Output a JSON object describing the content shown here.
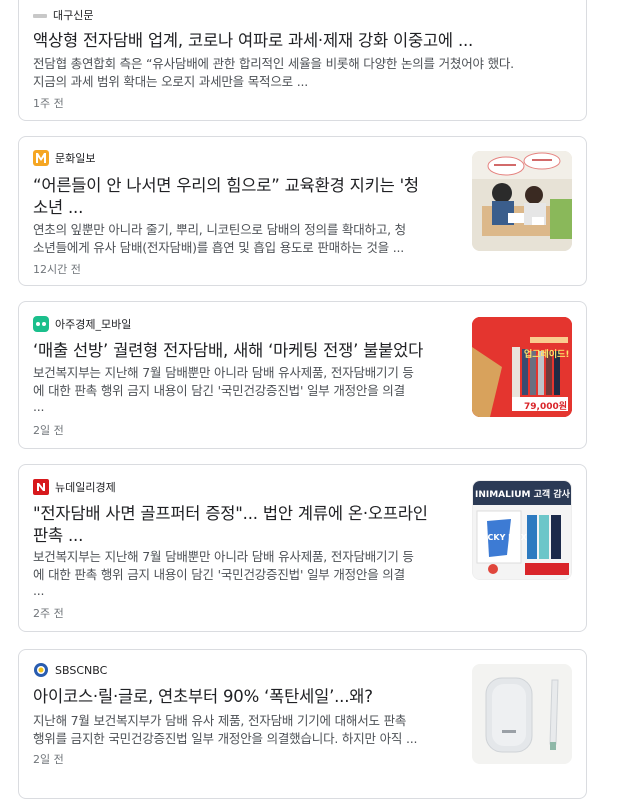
{
  "articles": [
    {
      "source": "대구신문",
      "title": "액상형 전자담배 업계, 코로나 여파로 과세·제재 강화 이중고에 ...",
      "snippet1": "전담협 총연합회 측은 “유사담배에 관한 합리적인 세율을 비롯해 다양한 논의를 거쳤어야 했다.",
      "snippet2": "지금의 과세 범위 확대는 오로지 과세만을 목적으로 ...",
      "snippet3": "",
      "time": "1주 전"
    },
    {
      "source": "문화일보",
      "title1": "“어른들이 안 나서면 우리의 힘으로” 교육환경 지키는 '청",
      "title2": "소년 ...",
      "snippet1": "연초의 잎뿐만 아니라 줄기, 뿌리, 니코틴으로 담배의 정의를 확대하고, 청",
      "snippet2": "소년들에게 유사 담배(전자담배)를 흡연 및 흡입 용도로 판매하는 것을 ...",
      "snippet3": "",
      "time": "12시간 전"
    },
    {
      "source": "아주경제_모바일",
      "title1": "‘매출 선방’ 궐련형 전자담배, 새해 ‘마케팅 전쟁’ 불붙었다",
      "title2": "",
      "snippet1": "보건복지부는 지난해 7월 담배뿐만 아니라 담배 유사제품, 전자담배기기 등",
      "snippet2": "에 대한 판촉 행위 금지 내용이 담긴 '국민건강증진법' 일부 개정안을 의결",
      "snippet3": "...",
      "time": "2일 전",
      "thumb_badge": "업그레이드!",
      "thumb_price": "79,000원"
    },
    {
      "source": "뉴데일리경제",
      "title1": "\"전자담배 사면 골프퍼터 증정\"... 법안 계류에 온·오프라인",
      "title2": "판촉 ...",
      "snippet1": "보건복지부는 지난해 7월 담배뿐만 아니라 담배 유사제품, 전자담배기기 등",
      "snippet2": "에 대한 판촉 행위 금지 내용이 담긴 '국민건강증진법' 일부 개정안을 의결",
      "snippet3": "...",
      "time": "2주 전",
      "thumb_text": "INIMALIUM 고객 감사",
      "thumb_box": "UCKY BOX"
    },
    {
      "source": "SBSCNBC",
      "title1": "아이코스·릴·글로, 연초부터 90% ‘폭탄세일’...왜?",
      "title2": "",
      "snippet1": "지난해 7월 보건복지부가 담배 유사 제품, 전자담배 기기에 대해서도 판촉",
      "snippet2": "행위를 금지한 국민건강증진법 일부 개정안을 의결했습니다. 하지만 아직 ...",
      "snippet3": "",
      "time": "2일 전"
    }
  ],
  "colors": {
    "border": "#dadce0",
    "muhwa_orange": "#f5a623",
    "ajou_green": "#1bbf8c",
    "newdaily_red": "#d7191c",
    "sbs_blue": "#2a5db0",
    "sbs_yellow": "#f3c318",
    "promo_red": "#d9252a"
  }
}
